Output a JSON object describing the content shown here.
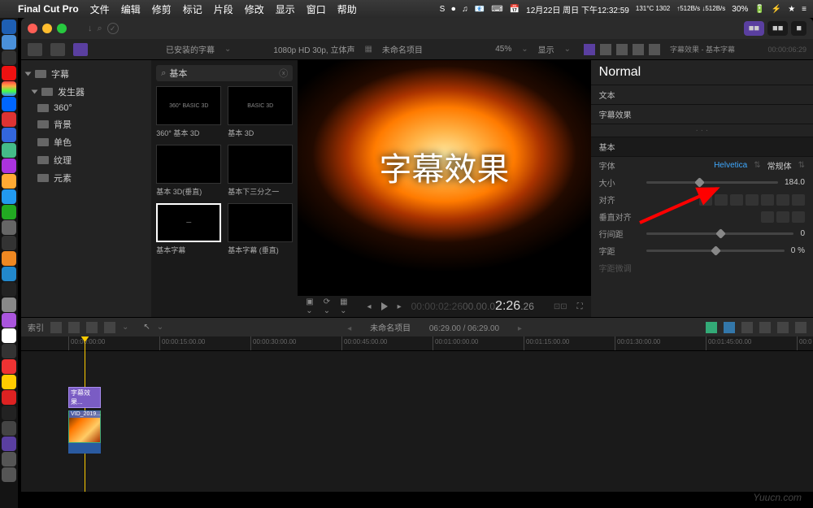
{
  "menubar": {
    "app": "Final Cut Pro",
    "items": [
      "文件",
      "编辑",
      "修剪",
      "标记",
      "片段",
      "修改",
      "显示",
      "窗口",
      "帮助"
    ],
    "date": "12月22日 周日 下午12:32:59",
    "temp": "131°C 1302",
    "net": "↑512B/s ↓512B/s",
    "battery": "30%",
    "spacer_icons": [
      "S",
      "⏺",
      "♫",
      "📧",
      "⌨",
      "📅"
    ]
  },
  "titlebar": {
    "key_icon": "⌕",
    "check_icon": "✓"
  },
  "toolbar": {
    "installed_label": "已安装的字幕",
    "format": "1080p HD 30p, 立体声",
    "project": "未命名项目",
    "zoom": "45%",
    "display": "显示",
    "insp_title": "字幕效果 - 基本字幕",
    "insp_tc": "00:00:06:29"
  },
  "sidebar": {
    "root": "字幕",
    "items": [
      {
        "label": "发生器"
      },
      {
        "label": "360°"
      },
      {
        "label": "背景"
      },
      {
        "label": "单色"
      },
      {
        "label": "纹理"
      },
      {
        "label": "元素"
      }
    ]
  },
  "search": {
    "value": "基本"
  },
  "thumbs": [
    {
      "label": "360° 基本 3D",
      "text": "360° BASIC 3D"
    },
    {
      "label": "基本 3D",
      "text": "BASIC 3D"
    },
    {
      "label": "基本 3D(垂直)",
      "text": ""
    },
    {
      "label": "基本下三分之一",
      "text": ""
    },
    {
      "label": "基本字幕",
      "text": "",
      "selected": true
    },
    {
      "label": "基本字幕 (垂直)",
      "text": ""
    }
  ],
  "viewer": {
    "title_text": "字幕效果",
    "timecode": "00:00:02:26",
    "big_time": "2:26",
    "tc_frames": "26"
  },
  "inspector": {
    "title": "Normal",
    "text_section": "文本",
    "effect_name": "字幕效果",
    "basic_section": "基本",
    "rows": {
      "font_label": "字体",
      "font_value": "Helvetica",
      "font_style": "常规体",
      "size_label": "大小",
      "size_value": "184.0",
      "align_label": "对齐",
      "valign_label": "垂直对齐",
      "line_label": "行间距",
      "line_value": "0",
      "track_label": "字距",
      "track_value": "0 %",
      "baseline_label": "字距微调"
    }
  },
  "lower_tb": {
    "index": "索引",
    "project": "未命名项目",
    "time": "06:29.00 / 06:29.00"
  },
  "ruler": [
    "00:00:00:00",
    "00:00:15:00.00",
    "00:00:30:00.00",
    "00:00:45:00.00",
    "00:01:00:00.00",
    "00:01:15:00.00",
    "00:01:30:00.00",
    "00:01:45:00.00",
    "00:0"
  ],
  "clip": {
    "title": "字幕效果...",
    "video": "VID_2019..."
  },
  "watermark": "Yuucn.com"
}
